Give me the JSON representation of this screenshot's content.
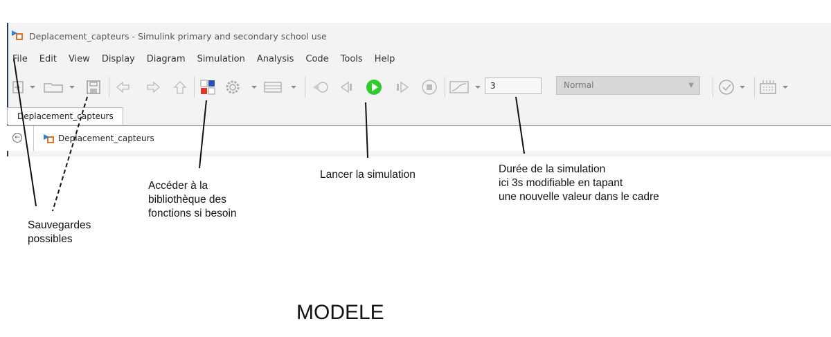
{
  "window": {
    "title": "Deplacement_capteurs - Simulink primary and secondary school use"
  },
  "menu": [
    "File",
    "Edit",
    "View",
    "Display",
    "Diagram",
    "Simulation",
    "Analysis",
    "Code",
    "Tools",
    "Help"
  ],
  "toolbar": {
    "stop_time": "3",
    "sim_mode": "Normal",
    "run_color": "#2ecc2e"
  },
  "tabs": {
    "model_tab": "Deplacement_capteurs"
  },
  "address": {
    "model_path": "Deplacement_capteurs"
  },
  "annotations": {
    "save": [
      "Sauvegardes",
      "possibles"
    ],
    "library": [
      "Accéder à la",
      "bibliothèque des",
      "fonctions si besoin"
    ],
    "run": [
      "Lancer la simulation"
    ],
    "duration": [
      "Durée de la simulation",
      "ici 3s  modifiable en tapant",
      "une nouvelle valeur dans le cadre"
    ]
  },
  "heading": "MODELE"
}
